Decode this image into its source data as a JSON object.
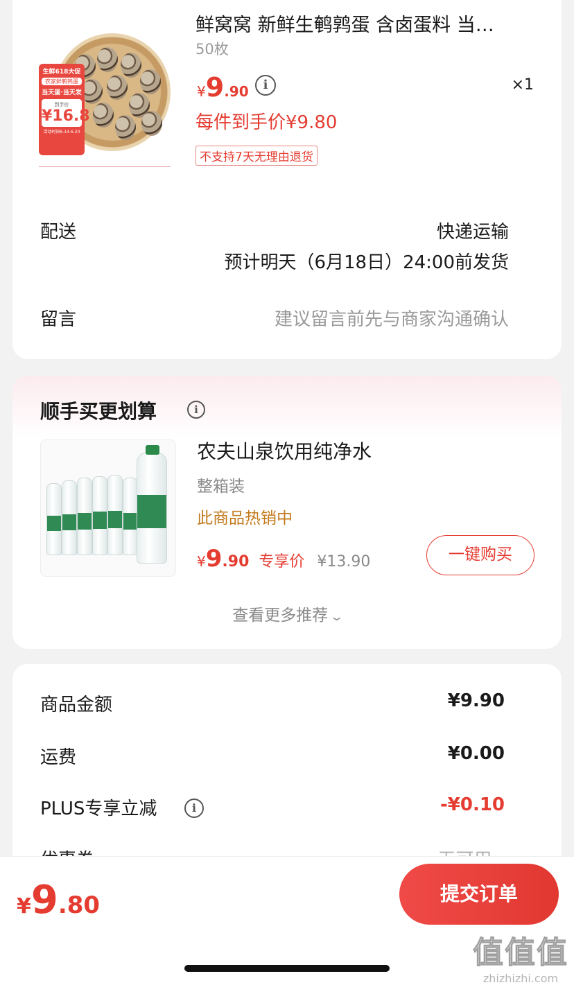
{
  "product": {
    "title": "鲜窝窝 新鲜生鹌鹑蛋 含卤蛋料 当…",
    "spec": "50枚",
    "price_yen": "¥",
    "price_int": "9",
    "price_dec": ".90",
    "price_info_icon": "i",
    "quantity": "×1",
    "final_price": "每件到手价¥9.80",
    "return_policy": "不支持7天无理由退货",
    "promo_tag": {
      "line1": "生鲜618大促",
      "line2": "农家鲜鹌鹑蛋",
      "line3": "当天蛋·当天发",
      "label": "到手价",
      "price": "¥16.8",
      "footer": "活动时间6.14-6.20"
    }
  },
  "delivery": {
    "label": "配送",
    "method": "快递运输",
    "estimate": "预计明天（6月18日）24:00前发货"
  },
  "message": {
    "label": "留言",
    "placeholder": "建议留言前先与商家沟通确认"
  },
  "recommend": {
    "title": "顺手买更划算",
    "info_icon": "i",
    "item": {
      "name": "农夫山泉饮用纯净水",
      "spec": "整箱装",
      "hot": "此商品热销中",
      "price_yen": "¥",
      "price_int": "9",
      "price_dec": ".90",
      "price_tag": "专享价",
      "orig_price": "¥13.90",
      "buy_label": "一键购买"
    },
    "more_label": "查看更多推荐",
    "more_icon": "⌄"
  },
  "summary": {
    "goods_label": "商品金额",
    "goods_value": "¥9.90",
    "shipping_label": "运费",
    "shipping_value": "¥0.00",
    "plus_label": "PLUS专享立减",
    "plus_info_icon": "i",
    "plus_value": "-¥0.10",
    "coupon_label": "优惠券",
    "coupon_value": "无可用 ›"
  },
  "bottom": {
    "total_yen": "¥",
    "total_int": "9",
    "total_dec": ".80",
    "submit_label": "提交订单"
  },
  "watermark": {
    "logo": "值值值",
    "url": "zhizhizhi.com"
  },
  "colors": {
    "accent": "#e53c31",
    "hot": "#c27a1d",
    "background": "#f2f2f2"
  }
}
